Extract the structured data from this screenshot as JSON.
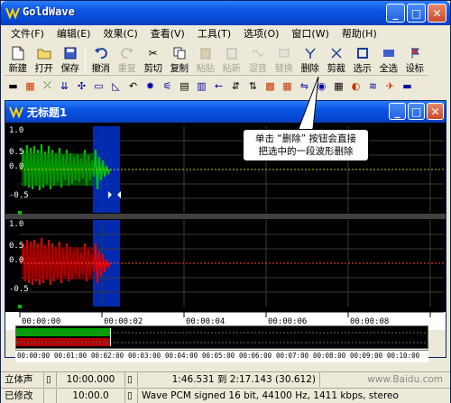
{
  "window": {
    "title": "GoldWave"
  },
  "menubar": [
    "文件(F)",
    "编辑(E)",
    "效果(C)",
    "查看(V)",
    "工具(T)",
    "选项(O)",
    "窗口(W)",
    "帮助(H)"
  ],
  "toolbar": [
    {
      "label": "新建",
      "icon": "new-file-icon",
      "enabled": true
    },
    {
      "label": "打开",
      "icon": "open-folder-icon",
      "enabled": true
    },
    {
      "label": "保存",
      "icon": "save-disk-icon",
      "enabled": true
    },
    {
      "label": "撤消",
      "icon": "undo-icon",
      "enabled": true
    },
    {
      "label": "重复",
      "icon": "redo-icon",
      "enabled": false
    },
    {
      "label": "剪切",
      "icon": "scissors-icon",
      "enabled": true
    },
    {
      "label": "复制",
      "icon": "copy-icon",
      "enabled": true
    },
    {
      "label": "粘贴",
      "icon": "paste-icon",
      "enabled": false
    },
    {
      "label": "粘新",
      "icon": "paste-new-icon",
      "enabled": false
    },
    {
      "label": "混音",
      "icon": "mix-icon",
      "enabled": false
    },
    {
      "label": "替换",
      "icon": "replace-icon",
      "enabled": false
    },
    {
      "label": "删除",
      "icon": "delete-icon",
      "enabled": true
    },
    {
      "label": "剪裁",
      "icon": "trim-icon",
      "enabled": true
    },
    {
      "label": "选示",
      "icon": "show-selection-icon",
      "enabled": true
    },
    {
      "label": "全选",
      "icon": "select-all-icon",
      "enabled": true
    },
    {
      "label": "设标",
      "icon": "set-marker-icon",
      "enabled": true
    }
  ],
  "document": {
    "title": "无标题1"
  },
  "y_labels": [
    "1.0",
    "0.5",
    "0.0",
    "-0.5"
  ],
  "time_labels": [
    "00:00:00",
    "00:00:02",
    "00:00:04",
    "00:00:06",
    "00:00:08"
  ],
  "overview_time_labels": [
    "00:00:00",
    "00:01:00",
    "00:02:00",
    "00:03:00",
    "00:04:00",
    "00:05:00",
    "00:06:00",
    "00:07:00",
    "00:08:00",
    "00:09:00",
    "00:10:00"
  ],
  "callout": {
    "line1": "单击 “删除” 按钮会直接",
    "line2": "把选中的一段波形删除"
  },
  "status": {
    "row1": {
      "channel": "立体声",
      "length": "10:00.000",
      "selection": "1:46.531 到 2:17.143 (30.612)",
      "watermark": "www.Baidu.com"
    },
    "row2": {
      "state": "已修改",
      "zoom": "10:00.0",
      "format": "Wave PCM signed 16 bit, 44100 Hz, 1411 kbps, stereo"
    }
  },
  "colors": {
    "left_channel": "#00c000",
    "right_channel": "#e00000",
    "selection": "#0033cc",
    "center_line_left": "#c8c800",
    "center_line_right": "#ff4040"
  }
}
